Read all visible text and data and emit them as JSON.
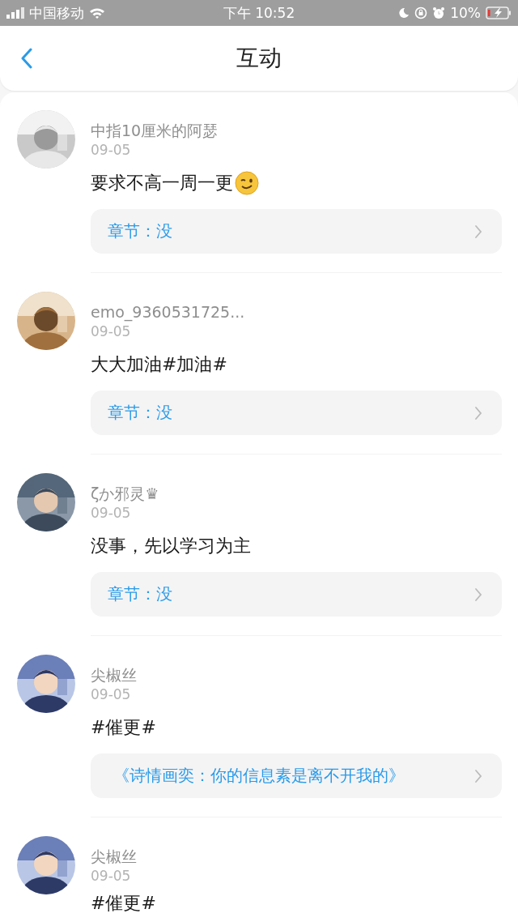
{
  "status_bar": {
    "carrier": "中国移动",
    "time": "下午 10:52",
    "battery": "10%"
  },
  "nav": {
    "title": "互动"
  },
  "comments": [
    {
      "user": "中指10厘米的阿瑟",
      "date": "09-05",
      "text": "要求不高一周一更",
      "kind": "with_wink_emoji",
      "link": {
        "kind": "chapter",
        "label": "章节：没"
      }
    },
    {
      "user": "emo_9360531725...",
      "date": "09-05",
      "text": "大大加油#加油#",
      "link": {
        "kind": "chapter",
        "label": "章节：没"
      }
    },
    {
      "user": "ζか邪灵♛",
      "date": "09-05",
      "text": "没事，先以学习为主",
      "link": {
        "kind": "chapter",
        "label": "章节：没"
      }
    },
    {
      "user": "尖椒丝",
      "date": "09-05",
      "text": "#催更#",
      "link": {
        "kind": "book",
        "label": "《诗情画奕：你的信息素是离不开我的》"
      }
    },
    {
      "user": "尖椒丝",
      "date": "09-05",
      "text": "#催更#"
    }
  ]
}
